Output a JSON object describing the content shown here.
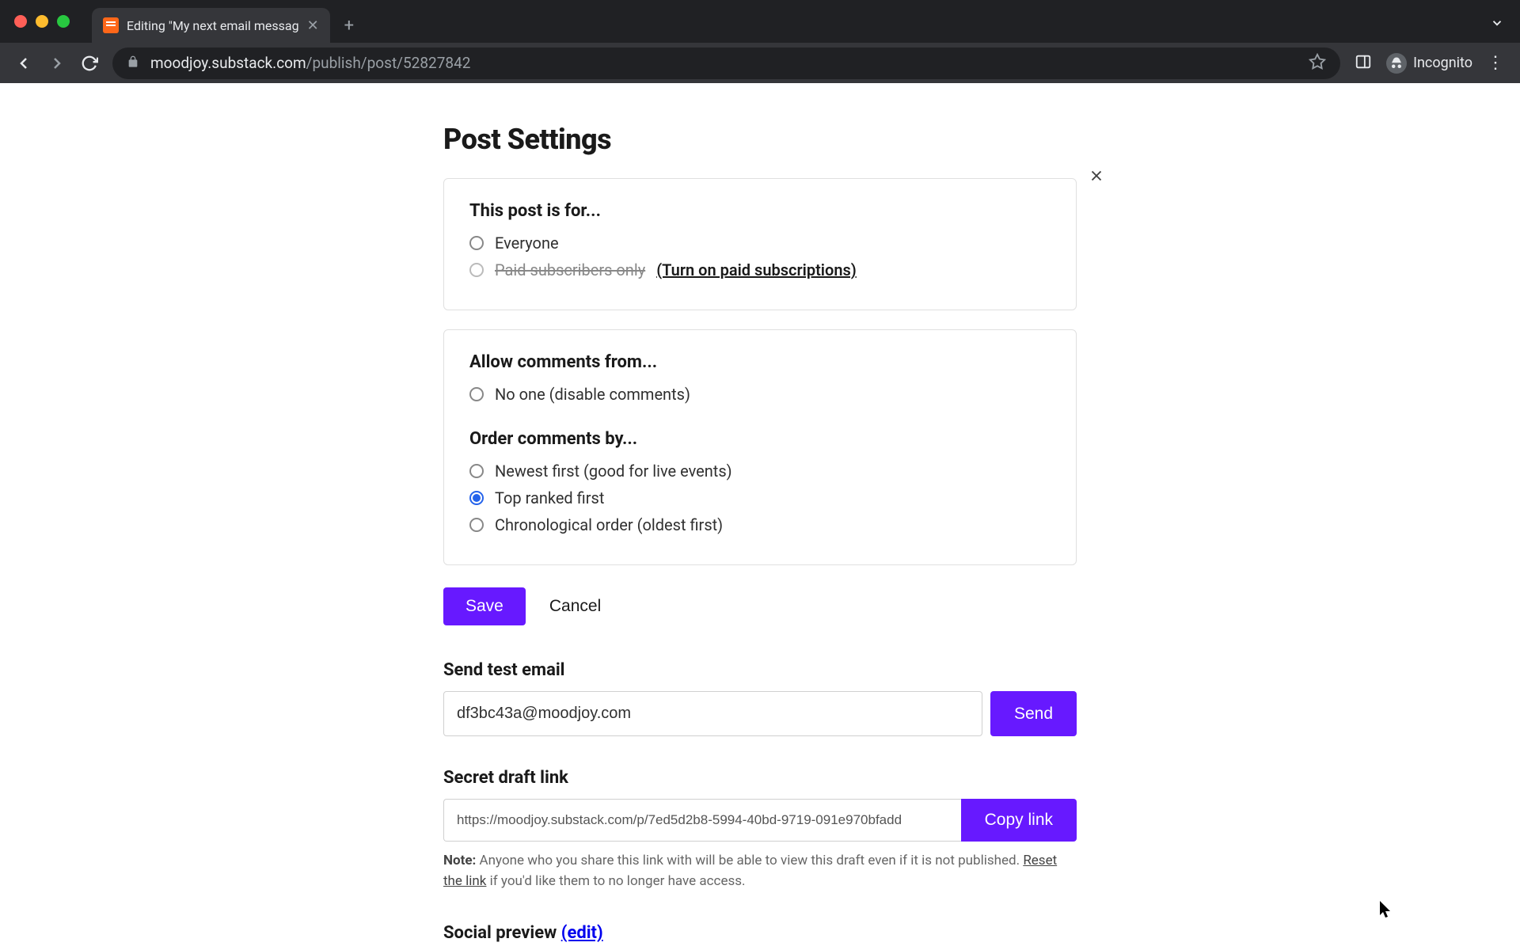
{
  "browser": {
    "tab_title": "Editing \"My next email messag",
    "url_host": "moodjoy.substack.com",
    "url_path": "/publish/post/52827842",
    "incognito_label": "Incognito"
  },
  "page": {
    "title": "Post Settings"
  },
  "audience": {
    "heading": "This post is for...",
    "options": {
      "everyone": "Everyone",
      "paid": "Paid subscribers only",
      "paid_link": "(Turn on paid subscriptions)"
    }
  },
  "comments": {
    "allow_heading": "Allow comments from...",
    "none": "No one (disable comments)",
    "order_heading": "Order comments by...",
    "newest": "Newest first (good for live events)",
    "top": "Top ranked first",
    "chrono": "Chronological order (oldest first)"
  },
  "actions": {
    "save": "Save",
    "cancel": "Cancel"
  },
  "test_email": {
    "label": "Send test email",
    "value": "df3bc43a@moodjoy.com",
    "button": "Send"
  },
  "draft_link": {
    "label": "Secret draft link",
    "value": "https://moodjoy.substack.com/p/7ed5d2b8-5994-40bd-9719-091e970bfadd",
    "button": "Copy link",
    "note_bold": "Note:",
    "note_text_1": " Anyone who you share this link with will be able to view this draft even if it is not published. ",
    "note_reset": "Reset the link",
    "note_text_2": " if you'd like them to no longer have access."
  },
  "social": {
    "label": "Social preview ",
    "edit": "(edit)"
  }
}
